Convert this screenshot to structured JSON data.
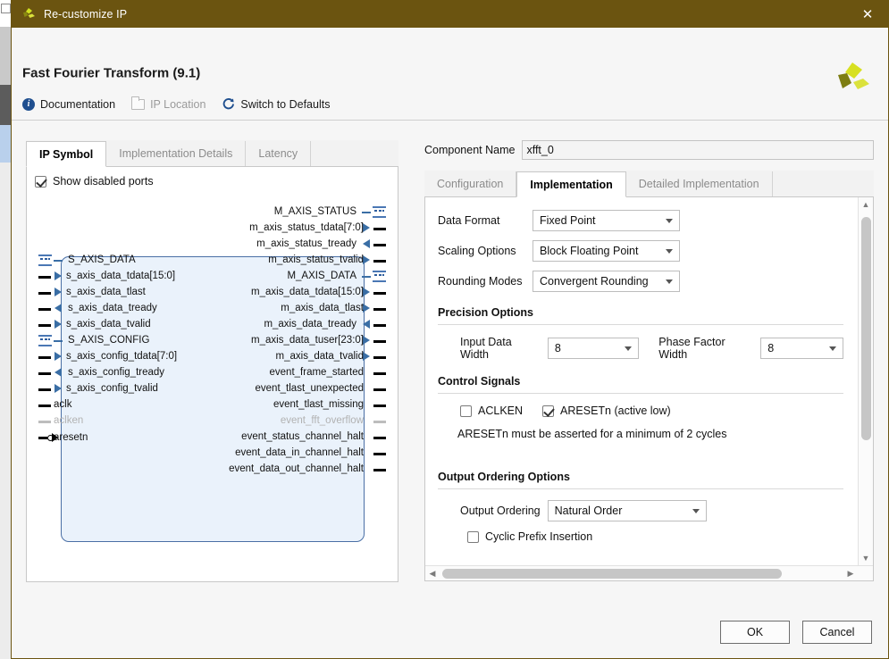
{
  "window": {
    "title": "Re-customize IP",
    "close_label": "✕",
    "logo_name": "xilinx-logo"
  },
  "header": {
    "title": "Fast Fourier Transform (9.1)",
    "toolbar": [
      {
        "label": "Documentation",
        "icon": "info-icon",
        "disabled": false
      },
      {
        "label": "IP Location",
        "icon": "folder-icon",
        "disabled": true
      },
      {
        "label": "Switch to Defaults",
        "icon": "refresh-icon",
        "disabled": false
      }
    ]
  },
  "left_pane": {
    "tabs": [
      {
        "label": "IP Symbol",
        "active": true
      },
      {
        "label": "Implementation Details",
        "active": false
      },
      {
        "label": "Latency",
        "active": false
      }
    ],
    "show_disabled_ports": {
      "label": "Show disabled ports",
      "checked": true
    },
    "symbol": {
      "left_ports": [
        {
          "label": "S_AXIS_DATA",
          "kind": "bus",
          "disabled": false
        },
        {
          "label": "s_axis_data_tdata[15:0]",
          "kind": "in",
          "disabled": false
        },
        {
          "label": "s_axis_data_tlast",
          "kind": "in",
          "disabled": false
        },
        {
          "label": "s_axis_data_tready",
          "kind": "out",
          "disabled": false
        },
        {
          "label": "s_axis_data_tvalid",
          "kind": "in",
          "disabled": false
        },
        {
          "label": "S_AXIS_CONFIG",
          "kind": "bus",
          "disabled": false
        },
        {
          "label": "s_axis_config_tdata[7:0]",
          "kind": "in",
          "disabled": false
        },
        {
          "label": "s_axis_config_tready",
          "kind": "out",
          "disabled": false
        },
        {
          "label": "s_axis_config_tvalid",
          "kind": "in",
          "disabled": false
        },
        {
          "label": "aclk",
          "kind": "plain",
          "disabled": false
        },
        {
          "label": "aclken",
          "kind": "plain",
          "disabled": true
        },
        {
          "label": "aresetn",
          "kind": "clock-neg",
          "disabled": false
        }
      ],
      "right_ports": [
        {
          "label": "M_AXIS_STATUS",
          "kind": "bus",
          "disabled": false
        },
        {
          "label": "m_axis_status_tdata[7:0]",
          "kind": "out",
          "disabled": false
        },
        {
          "label": "m_axis_status_tready",
          "kind": "in",
          "disabled": false
        },
        {
          "label": "m_axis_status_tvalid",
          "kind": "out",
          "disabled": false
        },
        {
          "label": "M_AXIS_DATA",
          "kind": "bus",
          "disabled": false
        },
        {
          "label": "m_axis_data_tdata[15:0]",
          "kind": "out",
          "disabled": false
        },
        {
          "label": "m_axis_data_tlast",
          "kind": "out",
          "disabled": false
        },
        {
          "label": "m_axis_data_tready",
          "kind": "in",
          "disabled": false
        },
        {
          "label": "m_axis_data_tuser[23:0]",
          "kind": "out",
          "disabled": false
        },
        {
          "label": "m_axis_data_tvalid",
          "kind": "out",
          "disabled": false
        },
        {
          "label": "event_frame_started",
          "kind": "plain",
          "disabled": false
        },
        {
          "label": "event_tlast_unexpected",
          "kind": "plain",
          "disabled": false
        },
        {
          "label": "event_tlast_missing",
          "kind": "plain",
          "disabled": false
        },
        {
          "label": "event_fft_overflow",
          "kind": "plain",
          "disabled": true
        },
        {
          "label": "event_status_channel_halt",
          "kind": "plain",
          "disabled": false
        },
        {
          "label": "event_data_in_channel_halt",
          "kind": "plain",
          "disabled": false
        },
        {
          "label": "event_data_out_channel_halt",
          "kind": "plain",
          "disabled": false
        }
      ]
    }
  },
  "right_pane": {
    "component_name": {
      "label": "Component Name",
      "value": "xfft_0",
      "placeholder": ""
    },
    "tabs": [
      {
        "label": "Configuration",
        "active": false
      },
      {
        "label": "Implementation",
        "active": true
      },
      {
        "label": "Detailed Implementation",
        "active": false
      }
    ],
    "fields": {
      "data_format": {
        "label": "Data Format",
        "value": "Fixed Point"
      },
      "scaling_options": {
        "label": "Scaling Options",
        "value": "Block Floating Point"
      },
      "rounding_modes": {
        "label": "Rounding Modes",
        "value": "Convergent Rounding"
      }
    },
    "precision_options": {
      "heading": "Precision Options",
      "input_data_width": {
        "label": "Input Data Width",
        "value": "8"
      },
      "phase_factor_width": {
        "label": "Phase Factor Width",
        "value": "8"
      }
    },
    "control_signals": {
      "heading": "Control Signals",
      "aclken": {
        "label": "ACLKEN",
        "checked": false
      },
      "aresetn": {
        "label": "ARESETn (active low)",
        "checked": true
      },
      "note": "ARESETn must be asserted for a minimum of 2 cycles"
    },
    "output_ordering_options": {
      "heading": "Output Ordering Options",
      "output_ordering": {
        "label": "Output Ordering",
        "value": "Natural Order"
      },
      "cyclic_prefix_insertion": {
        "label": "Cyclic Prefix Insertion",
        "checked": false
      }
    }
  },
  "footer": {
    "ok_label": "OK",
    "cancel_label": "Cancel"
  },
  "colors": {
    "titlebar": "#6b5410",
    "symbol_fill": "#eaf2fb",
    "symbol_border": "#4a6fa5",
    "accent_blue": "#3a6ea5",
    "logo_light": "#d7e021",
    "logo_dark": "#7d7d12"
  }
}
